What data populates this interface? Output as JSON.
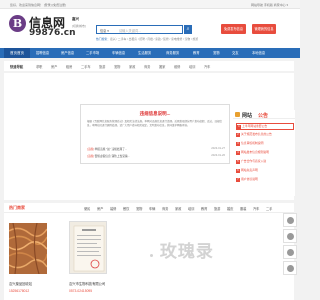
{
  "topbar": {
    "left": "您好，欢迎来到信息网！  [登录]  [免费注册]",
    "right": "网站导航   手机版   商家中心 ▾"
  },
  "logo": {
    "letter": "B",
    "name": "信息网",
    "url": "99876.cn"
  },
  "city": {
    "name": "嘉兴",
    "switch": "[切换城市]"
  },
  "search": {
    "category": "信息 ▾",
    "placeholder": "请输入关键词...",
    "hot_label": "热门搜索：",
    "hot_terms": "嘉兴 / 二手车 / 出租房 / 招聘 / 月嫂 / 家政 / 装修 / 家电维修 / 宠物 / 旅游"
  },
  "buttons": {
    "publish": "免费发布信息",
    "manage": "管理我的信息"
  },
  "nav": {
    "items": [
      "首页首页",
      "招聘信息",
      "房产信息",
      "二手市场",
      "车辆信息",
      "生活服务",
      "商务服务",
      "教育",
      "宠物",
      "交友",
      "本地信息"
    ]
  },
  "categories": {
    "label": "快速导航",
    "items": [
      "求职",
      "房产",
      "租房",
      "二手车",
      "旅游",
      "宠物",
      "家政",
      "商务",
      "搬家",
      "维修",
      "培训",
      "汽车"
    ]
  },
  "notice": {
    "title": "违规信息说明...",
    "body": "根据《互联网信息服务管理办法》及相关法律法规，本网对违规信息进行清理。近期发现部分用户发布虚假、违法、违规信息，本网站已进行删除处理，请广大用户遵守相关规定，文明发布信息，共同维护网络环境。",
    "rows": [
      {
        "tag": "[违规]",
        "text": "举报违规 \"如\" 违规处理了...",
        "date": "2023-01-27"
      },
      {
        "tag": "[违规]",
        "text": "警惕虚假信息 谨防上当受骗...",
        "date": "2023-01-26"
      }
    ]
  },
  "sidebar": {
    "title1": "网站",
    "title2": "公告",
    "items": [
      "上半年网站重要公告",
      "关于规范发布信息的公告",
      "信息审核机制说明",
      "网站发布信息规则说明",
      "广告合作与商家入驻",
      "网站免责声明",
      "用户协议说明"
    ]
  },
  "shop": {
    "title": "热门商家",
    "cats": [
      "便民",
      "房产",
      "装修",
      "餐饮",
      "宠物",
      "车辆",
      "商务",
      "家政",
      "培训",
      "教育",
      "旅游",
      "婚庆",
      "服装",
      "汽车",
      "二手"
    ]
  },
  "products": [
    {
      "title": "嘉兴废品回收站",
      "phone": "15256178012"
    },
    {
      "title": "嘉兴市生物科技有限公司",
      "phone": "0573-02415095"
    }
  ],
  "watermark": "玫瑰录"
}
